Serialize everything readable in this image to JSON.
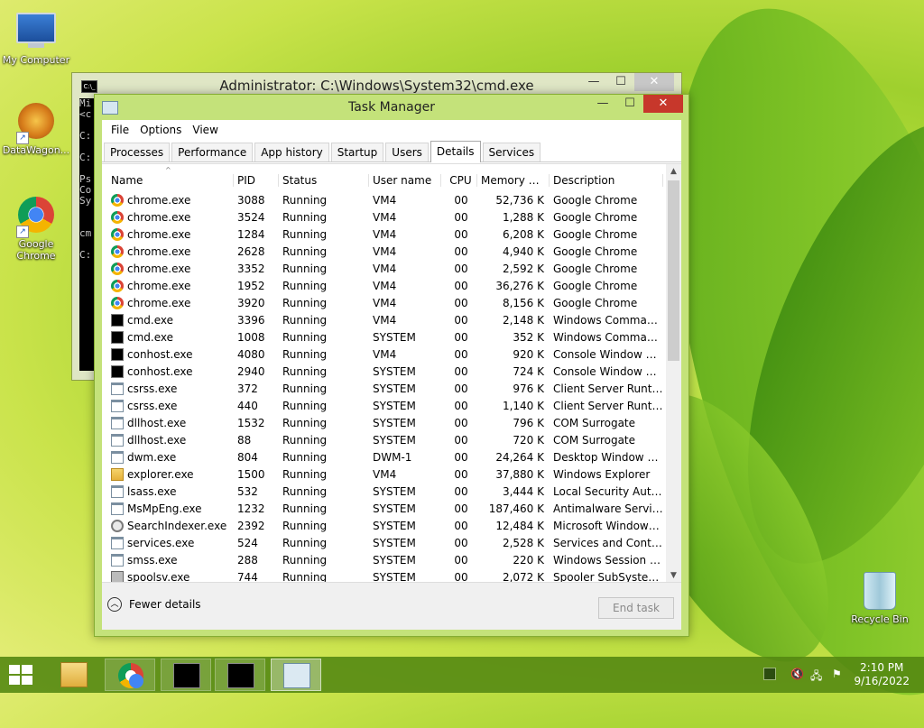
{
  "desktop": {
    "icons": [
      {
        "label": "My Computer"
      },
      {
        "label": "DataWagon..."
      },
      {
        "label": "Google Chrome"
      },
      {
        "label": "Recycle Bin"
      }
    ]
  },
  "cmd_window": {
    "title": "Administrator: C:\\Windows\\System32\\cmd.exe",
    "body_text": "Mi\n<c\n\nC:\n\nC:\n\nPs\nCo\nSy\n\n\ncm\n\nC:",
    "minimize": "—",
    "maximize": "☐",
    "close": "✕"
  },
  "task_manager": {
    "title": "Task Manager",
    "minimize": "—",
    "maximize": "☐",
    "close": "✕",
    "menu": [
      "File",
      "Options",
      "View"
    ],
    "tabs": [
      "Processes",
      "Performance",
      "App history",
      "Startup",
      "Users",
      "Details",
      "Services"
    ],
    "active_tab": "Details",
    "columns": {
      "name": "Name",
      "pid": "PID",
      "status": "Status",
      "user": "User name",
      "cpu": "CPU",
      "memory": "Memory (p...",
      "description": "Description"
    },
    "rows": [
      {
        "icon": "chrome",
        "name": "chrome.exe",
        "pid": "3088",
        "status": "Running",
        "user": "VM4",
        "cpu": "00",
        "memory": "52,736 K",
        "description": "Google Chrome"
      },
      {
        "icon": "chrome",
        "name": "chrome.exe",
        "pid": "3524",
        "status": "Running",
        "user": "VM4",
        "cpu": "00",
        "memory": "1,288 K",
        "description": "Google Chrome"
      },
      {
        "icon": "chrome",
        "name": "chrome.exe",
        "pid": "1284",
        "status": "Running",
        "user": "VM4",
        "cpu": "00",
        "memory": "6,208 K",
        "description": "Google Chrome"
      },
      {
        "icon": "chrome",
        "name": "chrome.exe",
        "pid": "2628",
        "status": "Running",
        "user": "VM4",
        "cpu": "00",
        "memory": "4,940 K",
        "description": "Google Chrome"
      },
      {
        "icon": "chrome",
        "name": "chrome.exe",
        "pid": "3352",
        "status": "Running",
        "user": "VM4",
        "cpu": "00",
        "memory": "2,592 K",
        "description": "Google Chrome"
      },
      {
        "icon": "chrome",
        "name": "chrome.exe",
        "pid": "1952",
        "status": "Running",
        "user": "VM4",
        "cpu": "00",
        "memory": "36,276 K",
        "description": "Google Chrome"
      },
      {
        "icon": "chrome",
        "name": "chrome.exe",
        "pid": "3920",
        "status": "Running",
        "user": "VM4",
        "cpu": "00",
        "memory": "8,156 K",
        "description": "Google Chrome"
      },
      {
        "icon": "cmd",
        "name": "cmd.exe",
        "pid": "3396",
        "status": "Running",
        "user": "VM4",
        "cpu": "00",
        "memory": "2,148 K",
        "description": "Windows Comman..."
      },
      {
        "icon": "cmd",
        "name": "cmd.exe",
        "pid": "1008",
        "status": "Running",
        "user": "SYSTEM",
        "cpu": "00",
        "memory": "352 K",
        "description": "Windows Comman..."
      },
      {
        "icon": "cmd",
        "name": "conhost.exe",
        "pid": "4080",
        "status": "Running",
        "user": "VM4",
        "cpu": "00",
        "memory": "920 K",
        "description": "Console Window H..."
      },
      {
        "icon": "cmd",
        "name": "conhost.exe",
        "pid": "2940",
        "status": "Running",
        "user": "SYSTEM",
        "cpu": "00",
        "memory": "724 K",
        "description": "Console Window H..."
      },
      {
        "icon": "app",
        "name": "csrss.exe",
        "pid": "372",
        "status": "Running",
        "user": "SYSTEM",
        "cpu": "00",
        "memory": "976 K",
        "description": "Client Server Runtim..."
      },
      {
        "icon": "app",
        "name": "csrss.exe",
        "pid": "440",
        "status": "Running",
        "user": "SYSTEM",
        "cpu": "00",
        "memory": "1,140 K",
        "description": "Client Server Runtim..."
      },
      {
        "icon": "app",
        "name": "dllhost.exe",
        "pid": "1532",
        "status": "Running",
        "user": "SYSTEM",
        "cpu": "00",
        "memory": "796 K",
        "description": "COM Surrogate"
      },
      {
        "icon": "app",
        "name": "dllhost.exe",
        "pid": "88",
        "status": "Running",
        "user": "SYSTEM",
        "cpu": "00",
        "memory": "720 K",
        "description": "COM Surrogate"
      },
      {
        "icon": "app",
        "name": "dwm.exe",
        "pid": "804",
        "status": "Running",
        "user": "DWM-1",
        "cpu": "00",
        "memory": "24,264 K",
        "description": "Desktop Window M..."
      },
      {
        "icon": "folder",
        "name": "explorer.exe",
        "pid": "1500",
        "status": "Running",
        "user": "VM4",
        "cpu": "00",
        "memory": "37,880 K",
        "description": "Windows Explorer"
      },
      {
        "icon": "app",
        "name": "lsass.exe",
        "pid": "532",
        "status": "Running",
        "user": "SYSTEM",
        "cpu": "00",
        "memory": "3,444 K",
        "description": "Local Security Auth..."
      },
      {
        "icon": "app",
        "name": "MsMpEng.exe",
        "pid": "1232",
        "status": "Running",
        "user": "SYSTEM",
        "cpu": "00",
        "memory": "187,460 K",
        "description": "Antimalware Service..."
      },
      {
        "icon": "search",
        "name": "SearchIndexer.exe",
        "pid": "2392",
        "status": "Running",
        "user": "SYSTEM",
        "cpu": "00",
        "memory": "12,484 K",
        "description": "Microsoft Windows ..."
      },
      {
        "icon": "app",
        "name": "services.exe",
        "pid": "524",
        "status": "Running",
        "user": "SYSTEM",
        "cpu": "00",
        "memory": "2,528 K",
        "description": "Services and Control..."
      },
      {
        "icon": "app",
        "name": "smss.exe",
        "pid": "288",
        "status": "Running",
        "user": "SYSTEM",
        "cpu": "00",
        "memory": "220 K",
        "description": "Windows Session M..."
      },
      {
        "icon": "printer",
        "name": "spoolsv.exe",
        "pid": "744",
        "status": "Running",
        "user": "SYSTEM",
        "cpu": "00",
        "memory": "2,072 K",
        "description": "Spooler SubSystem ..."
      }
    ],
    "fewer_details": "Fewer details",
    "end_task": "End task"
  },
  "taskbar": {
    "time": "2:10 PM",
    "date": "9/16/2022"
  },
  "colors": {
    "close_button": "#c7372b",
    "window_frame": "#c4e27a",
    "taskbar": "#548812"
  }
}
